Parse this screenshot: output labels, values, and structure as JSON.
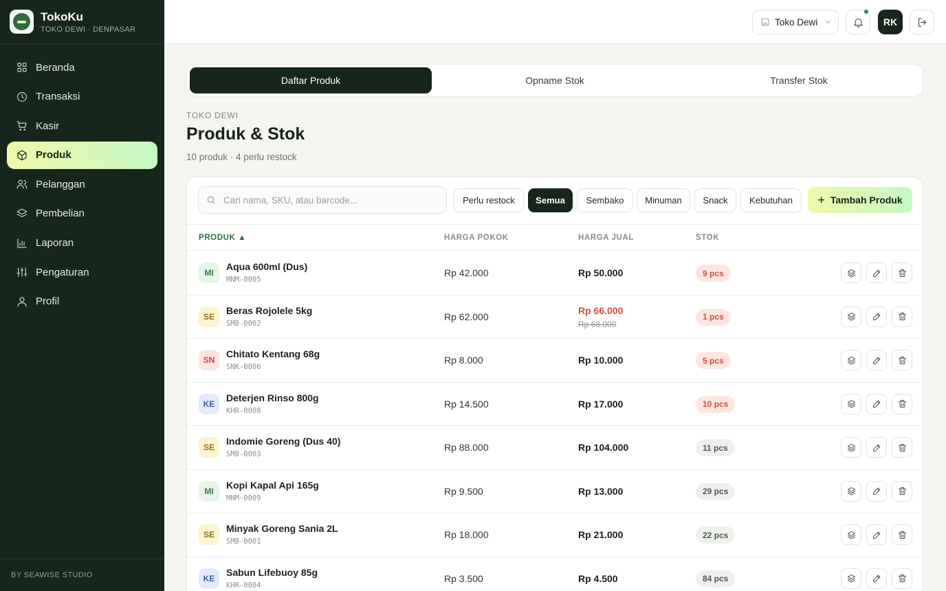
{
  "app": {
    "name": "TokoKu",
    "subtitle": "TOKO DEWI · DENPASAR",
    "footer": "BY SEAWISE STUDIO"
  },
  "sidebar": {
    "items": [
      {
        "label": "Beranda",
        "icon": "grid-icon",
        "active": false
      },
      {
        "label": "Transaksi",
        "icon": "clock-icon",
        "active": false
      },
      {
        "label": "Kasir",
        "icon": "cart-icon",
        "active": false
      },
      {
        "label": "Produk",
        "icon": "box-icon",
        "active": true
      },
      {
        "label": "Pelanggan",
        "icon": "users-icon",
        "active": false
      },
      {
        "label": "Pembelian",
        "icon": "layers-icon",
        "active": false
      },
      {
        "label": "Laporan",
        "icon": "bar-chart-icon",
        "active": false
      },
      {
        "label": "Pengaturan",
        "icon": "sliders-icon",
        "active": false
      },
      {
        "label": "Profil",
        "icon": "user-icon",
        "active": false
      }
    ]
  },
  "topbar": {
    "store": "Toko Dewi",
    "avatar": "RK"
  },
  "tabs": [
    {
      "label": "Daftar Produk",
      "active": true
    },
    {
      "label": "Opname Stok",
      "active": false
    },
    {
      "label": "Transfer Stok",
      "active": false
    }
  ],
  "header": {
    "eyebrow": "TOKO DEWI",
    "title": "Produk & Stok",
    "summary": "10 produk · 4 perlu restock"
  },
  "search": {
    "placeholder": "Cari nama, SKU, atau barcode...",
    "value": ""
  },
  "filters": [
    {
      "label": "Perlu restock",
      "active": false
    },
    {
      "label": "Semua",
      "active": true
    },
    {
      "label": "Sembako",
      "active": false
    },
    {
      "label": "Minuman",
      "active": false
    },
    {
      "label": "Snack",
      "active": false
    },
    {
      "label": "Kebutuhan",
      "active": false
    }
  ],
  "add_button": "Tambah Produk",
  "columns": {
    "product": "PRODUK ▲",
    "cost": "HARGA POKOK",
    "price": "HARGA JUAL",
    "stock": "STOK"
  },
  "products": [
    {
      "badge": "MI",
      "badge_type": "mi",
      "name": "Aqua 600ml (Dus)",
      "sku": "MNM-0005",
      "cost": "Rp 42.000",
      "price": "Rp 50.000",
      "old_price": "",
      "stock": "9 pcs",
      "low": true
    },
    {
      "badge": "SE",
      "badge_type": "se",
      "name": "Beras Rojolele 5kg",
      "sku": "SMB-0002",
      "cost": "Rp 62.000",
      "price": "Rp 66.000",
      "old_price": "Rp 68.000",
      "stock": "1 pcs",
      "low": true
    },
    {
      "badge": "SN",
      "badge_type": "sn",
      "name": "Chitato Kentang 68g",
      "sku": "SNK-0006",
      "cost": "Rp 8.000",
      "price": "Rp 10.000",
      "old_price": "",
      "stock": "5 pcs",
      "low": true
    },
    {
      "badge": "KE",
      "badge_type": "ke",
      "name": "Deterjen Rinso 800g",
      "sku": "KHR-0008",
      "cost": "Rp 14.500",
      "price": "Rp 17.000",
      "old_price": "",
      "stock": "10 pcs",
      "low": true
    },
    {
      "badge": "SE",
      "badge_type": "se",
      "name": "Indomie Goreng (Dus 40)",
      "sku": "SMB-0003",
      "cost": "Rp 88.000",
      "price": "Rp 104.000",
      "old_price": "",
      "stock": "11 pcs",
      "low": false
    },
    {
      "badge": "MI",
      "badge_type": "mi",
      "name": "Kopi Kapal Api 165g",
      "sku": "MNM-0009",
      "cost": "Rp 9.500",
      "price": "Rp 13.000",
      "old_price": "",
      "stock": "29 pcs",
      "low": false
    },
    {
      "badge": "SE",
      "badge_type": "se",
      "name": "Minyak Goreng Sania 2L",
      "sku": "SMB-0001",
      "cost": "Rp 18.000",
      "price": "Rp 21.000",
      "old_price": "",
      "stock": "22 pcs",
      "low": false
    },
    {
      "badge": "KE",
      "badge_type": "ke",
      "name": "Sabun Lifebuoy 85g",
      "sku": "KHR-0004",
      "cost": "Rp 3.500",
      "price": "Rp 4.500",
      "old_price": "",
      "stock": "84 pcs",
      "low": false
    }
  ]
}
